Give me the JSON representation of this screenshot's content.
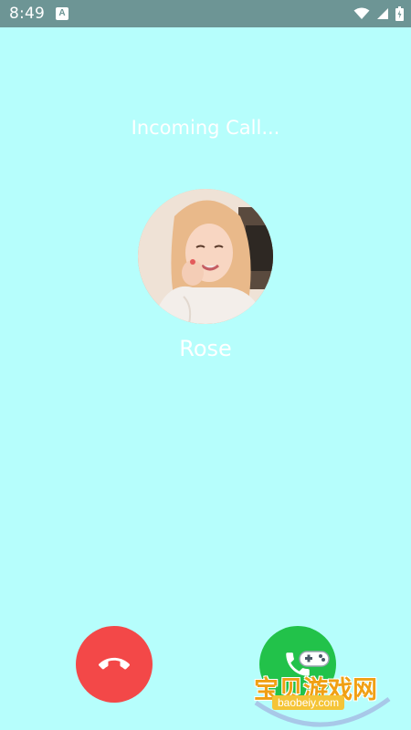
{
  "status_bar": {
    "time": "8:49",
    "notification_icon": "A",
    "icons": [
      "wifi-icon",
      "signal-icon",
      "battery-icon"
    ]
  },
  "call": {
    "status_text": "Incoming Call...",
    "caller_name": "Rose"
  },
  "actions": {
    "decline_icon": "phone-hangup-icon",
    "decline_color": "#f34848",
    "accept_icon": "phone-answer-icon",
    "accept_color": "#22c24a"
  },
  "watermark": {
    "text_cn": "宝贝游戏网",
    "url": "baobeiy.com"
  },
  "colors": {
    "background": "#b6fefc",
    "status_bar": "#6d9595"
  }
}
